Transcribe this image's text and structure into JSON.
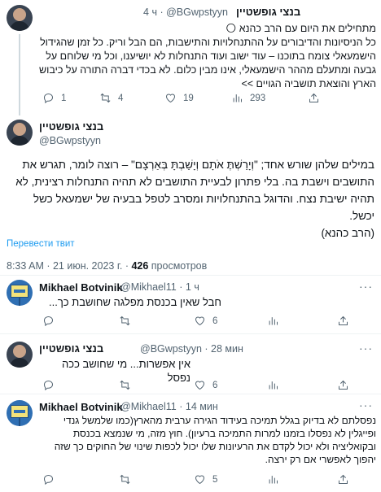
{
  "tweet1": {
    "name": "בנצי גופשטיין",
    "handle": "@BGwpstyyn",
    "dot": "·",
    "time": "4 ч",
    "more": "···",
    "lines": [
      "מתחילים את היום עם הרב כהנא 🌕",
      "כל הניסיונות והדיבורים על ההתנחלויות והתישבות, הם הבל וריק. כל זמן שהגידול",
      "הישמעאלי צומח בתוכנו – עוד ישוב ועוד התנחלות לא יושיענו, וכל מי שלוחם על",
      "גבעה ומתעלם מההר הישמעאלי, אינו מבין כלום. לא בכדי דברה התורה על כיבוש",
      "הארץ והוצאת תושביה הגויים >>"
    ],
    "replies": "1",
    "retweets": "4",
    "likes": "19",
    "views": "293"
  },
  "main_tweet": {
    "name": "בנצי גופשטיין",
    "handle": "@BGwpstyyn",
    "more": "···",
    "lines": [
      "במילים שלהן שורש אחד; \"וְיָרַשְׁתֶּ אֹתָם וְיָשַׁבְתָּ בְּאַרְצָם\" – רוצה לומר, תגרש את",
      "התושבים וישבת בה. בלי פתרון לבעיית התושבים לא תהיה התנחלות רצינית, לא",
      "תהיה ישיבת נצח. והדוגל בהתנחלויות ומסרב לטפל בבעיה של ישמעאל כשל",
      "יכשל.",
      "(הרב כהנא)"
    ],
    "translate": "Перевести твит",
    "time_text": "8:33 AM · 21 июн. 2023 г. · ",
    "views_count": "426",
    "views_label": " просмотров"
  },
  "reply1": {
    "name": "Mikhael Botvinik",
    "handle": "@Mikhael11",
    "dot": "·",
    "time": "1 ч",
    "more": "···",
    "text": "חבל שאין בכנסת מפלגה שחושבת כך...",
    "replies": "",
    "retweets": "",
    "likes": "6",
    "views": ""
  },
  "reply2": {
    "name": "בנצי גופשטיין",
    "handle": "@BGwpstyyn",
    "dot": "·",
    "time": "28 мин",
    "more": "···",
    "text": "אין אפשרות... מי שחושב ככה נפסל",
    "replies": "",
    "retweets": "",
    "likes": "6",
    "views": ""
  },
  "reply3": {
    "name": "Mikhael Botvinik",
    "handle": "@Mikhael11",
    "dot": "·",
    "time": "14 мин",
    "more": "···",
    "lines": [
      "נפסלתם לא בדיוק בגלל תמיכה בעידוד הגירה ערבית מהארץ(כמו שלמשל גנדי",
      "ופייגלין לא נפסלו בזמנו למרות התמיכה ברעיון). חוץ מזה, מי שנמצא בכנסת",
      "ובקואליציה ולא יכול לקדם את הרעיונות שלו יכול לכפות שינוי של החוקים כך שזה",
      "יהפוך לאפשרי אם רק ירצה."
    ],
    "replies": "",
    "retweets": "",
    "likes": "5",
    "views": ""
  },
  "icons": {
    "reply": "reply-icon",
    "retweet": "retweet-icon",
    "like": "heart-icon",
    "views": "views-icon"
  },
  "colors": {
    "link": "#1d9bf0",
    "muted": "#536471",
    "text": "#0f1419"
  }
}
